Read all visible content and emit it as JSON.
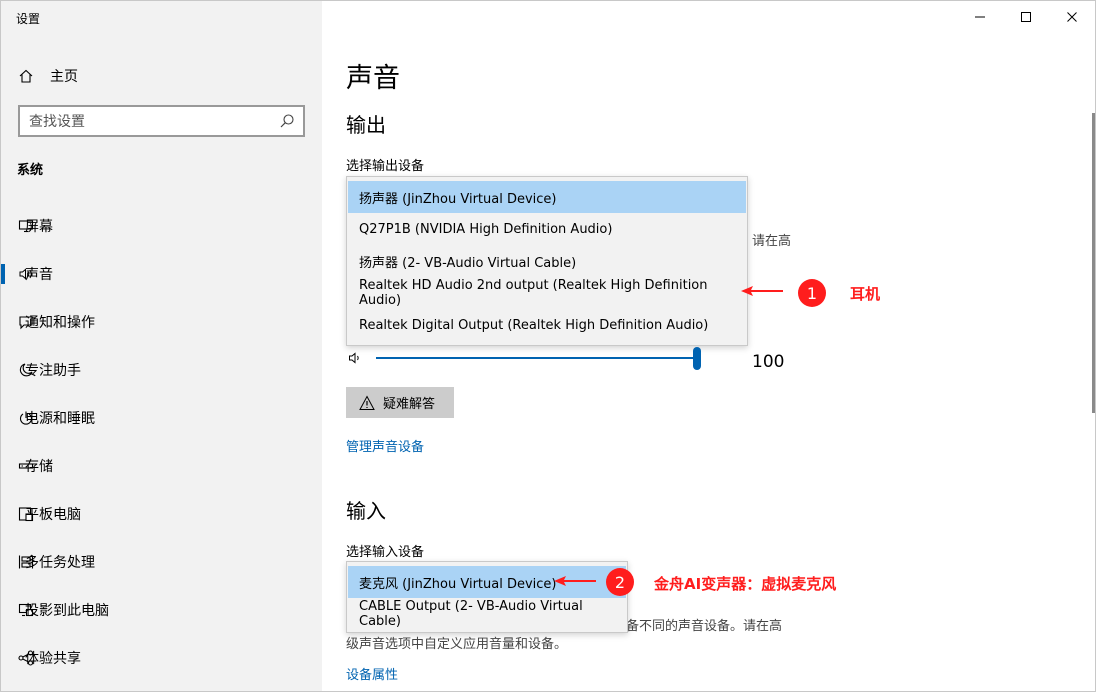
{
  "window": {
    "title": "设置"
  },
  "sidebar": {
    "home_label": "主页",
    "search_placeholder": "查找设置",
    "section_title": "系统",
    "items": [
      {
        "label": "屏幕",
        "icon": "monitor-icon"
      },
      {
        "label": "声音",
        "icon": "speaker-icon",
        "active": true
      },
      {
        "label": "通知和操作",
        "icon": "notification-icon"
      },
      {
        "label": "专注助手",
        "icon": "moon-icon"
      },
      {
        "label": "电源和睡眠",
        "icon": "power-icon"
      },
      {
        "label": "存储",
        "icon": "storage-icon"
      },
      {
        "label": "平板电脑",
        "icon": "tablet-icon"
      },
      {
        "label": "多任务处理",
        "icon": "multitask-icon"
      },
      {
        "label": "投影到此电脑",
        "icon": "project-icon"
      },
      {
        "label": "体验共享",
        "icon": "share-icon"
      }
    ]
  },
  "main": {
    "page_title": "声音",
    "output": {
      "heading": "输出",
      "select_label": "选择输出设备",
      "devices": [
        "扬声器 (JinZhou Virtual Device)",
        "Q27P1B (NVIDIA High Definition Audio)",
        "扬声器 (2- VB-Audio Virtual Cable)",
        "Realtek HD Audio 2nd output (Realtek High Definition Audio)",
        "Realtek Digital Output (Realtek High Definition Audio)"
      ],
      "selected_index": 0,
      "partial_text": "请在高",
      "volume": "100",
      "troubleshoot_label": "疑难解答",
      "manage_link": "管理声音设备"
    },
    "input": {
      "heading": "输入",
      "select_label": "选择输入设备",
      "devices": [
        "麦克风 (JinZhou Virtual Device)",
        "CABLE Output (2- VB-Audio Virtual Cable)"
      ],
      "selected_index": 0,
      "partial_text_line1": "备不同的声音设备。请在高",
      "partial_text_line2": "级声音选项中自定义应用音量和设备。",
      "properties_link": "设备属性"
    }
  },
  "annotations": [
    {
      "number": "1",
      "text": "耳机"
    },
    {
      "number": "2",
      "text": "金舟AI变声器：虚拟麦克风"
    }
  ],
  "colors": {
    "accent": "#0063b1",
    "annotation": "#ff1d1d",
    "selected_item": "#aad3f5",
    "sidebar_bg": "#f2f2f2"
  }
}
